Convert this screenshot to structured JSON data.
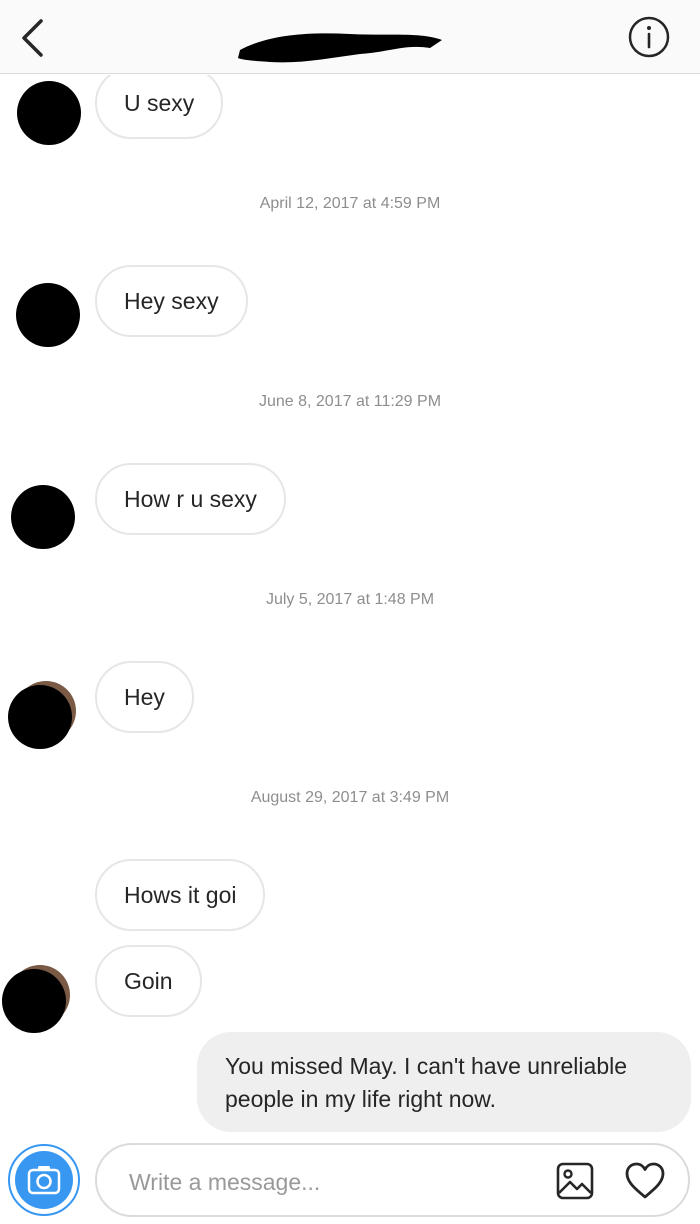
{
  "header": {
    "back_icon": "chevron-left-icon",
    "info_icon": "info-icon",
    "title_redacted": true
  },
  "messages": [
    {
      "type": "incoming",
      "text": "U sexy"
    },
    {
      "type": "timestamp",
      "text": "April 12, 2017 at 4:59 PM"
    },
    {
      "type": "incoming",
      "text": "Hey sexy"
    },
    {
      "type": "timestamp",
      "text": "June 8, 2017 at 11:29 PM"
    },
    {
      "type": "incoming",
      "text": "How r u sexy"
    },
    {
      "type": "timestamp",
      "text": "July 5, 2017 at 1:48 PM"
    },
    {
      "type": "incoming",
      "text": "Hey"
    },
    {
      "type": "timestamp",
      "text": "August 29, 2017 at 3:49 PM"
    },
    {
      "type": "incoming",
      "text": "Hows it goi"
    },
    {
      "type": "incoming",
      "text": "Goin"
    },
    {
      "type": "outgoing",
      "text": "You missed May. I can't have unreliable people in my life right now."
    }
  ],
  "composer": {
    "placeholder": "Write a message...",
    "camera_icon": "camera-icon",
    "gallery_icon": "image-icon",
    "like_icon": "heart-icon"
  },
  "colors": {
    "accent": "#3897f0",
    "outgoing_bubble": "#efefef",
    "bubble_border": "#e6e6e6",
    "timestamp_text": "#8e8e8e"
  }
}
